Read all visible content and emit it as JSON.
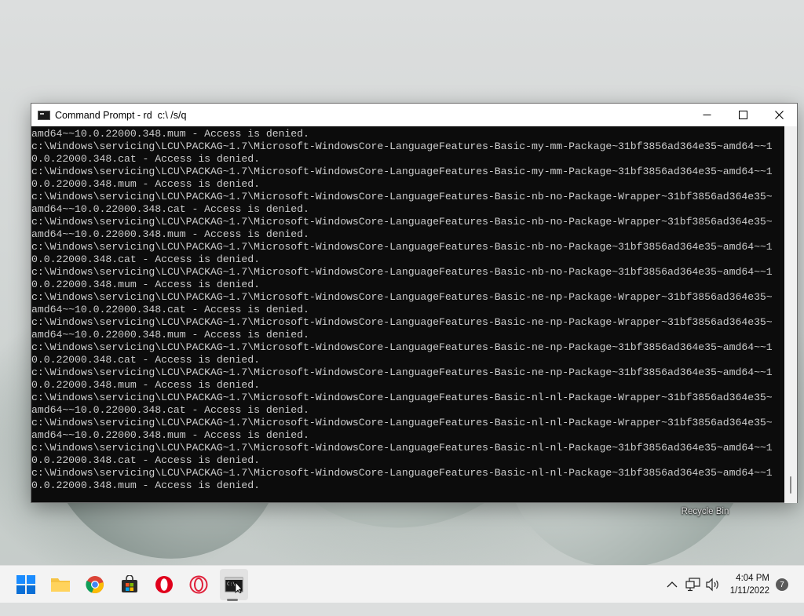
{
  "desktop": {
    "recycle_bin_label": "Recycle Bin"
  },
  "window": {
    "title": "Command Prompt - rd  c:\\ /s/q",
    "controls": {
      "minimize": "minimize-icon",
      "maximize": "maximize-icon",
      "close": "close-icon"
    },
    "console_lines": [
      "amd64~~10.0.22000.348.mum - Access is denied.",
      "c:\\Windows\\servicing\\LCU\\PACKAG~1.7\\Microsoft-WindowsCore-LanguageFeatures-Basic-my-mm-Package~31bf3856ad364e35~amd64~~1",
      "0.0.22000.348.cat - Access is denied.",
      "c:\\Windows\\servicing\\LCU\\PACKAG~1.7\\Microsoft-WindowsCore-LanguageFeatures-Basic-my-mm-Package~31bf3856ad364e35~amd64~~1",
      "0.0.22000.348.mum - Access is denied.",
      "c:\\Windows\\servicing\\LCU\\PACKAG~1.7\\Microsoft-WindowsCore-LanguageFeatures-Basic-nb-no-Package-Wrapper~31bf3856ad364e35~",
      "amd64~~10.0.22000.348.cat - Access is denied.",
      "c:\\Windows\\servicing\\LCU\\PACKAG~1.7\\Microsoft-WindowsCore-LanguageFeatures-Basic-nb-no-Package-Wrapper~31bf3856ad364e35~",
      "amd64~~10.0.22000.348.mum - Access is denied.",
      "c:\\Windows\\servicing\\LCU\\PACKAG~1.7\\Microsoft-WindowsCore-LanguageFeatures-Basic-nb-no-Package~31bf3856ad364e35~amd64~~1",
      "0.0.22000.348.cat - Access is denied.",
      "c:\\Windows\\servicing\\LCU\\PACKAG~1.7\\Microsoft-WindowsCore-LanguageFeatures-Basic-nb-no-Package~31bf3856ad364e35~amd64~~1",
      "0.0.22000.348.mum - Access is denied.",
      "c:\\Windows\\servicing\\LCU\\PACKAG~1.7\\Microsoft-WindowsCore-LanguageFeatures-Basic-ne-np-Package-Wrapper~31bf3856ad364e35~",
      "amd64~~10.0.22000.348.cat - Access is denied.",
      "c:\\Windows\\servicing\\LCU\\PACKAG~1.7\\Microsoft-WindowsCore-LanguageFeatures-Basic-ne-np-Package-Wrapper~31bf3856ad364e35~",
      "amd64~~10.0.22000.348.mum - Access is denied.",
      "c:\\Windows\\servicing\\LCU\\PACKAG~1.7\\Microsoft-WindowsCore-LanguageFeatures-Basic-ne-np-Package~31bf3856ad364e35~amd64~~1",
      "0.0.22000.348.cat - Access is denied.",
      "c:\\Windows\\servicing\\LCU\\PACKAG~1.7\\Microsoft-WindowsCore-LanguageFeatures-Basic-ne-np-Package~31bf3856ad364e35~amd64~~1",
      "0.0.22000.348.mum - Access is denied.",
      "c:\\Windows\\servicing\\LCU\\PACKAG~1.7\\Microsoft-WindowsCore-LanguageFeatures-Basic-nl-nl-Package-Wrapper~31bf3856ad364e35~",
      "amd64~~10.0.22000.348.cat - Access is denied.",
      "c:\\Windows\\servicing\\LCU\\PACKAG~1.7\\Microsoft-WindowsCore-LanguageFeatures-Basic-nl-nl-Package-Wrapper~31bf3856ad364e35~",
      "amd64~~10.0.22000.348.mum - Access is denied.",
      "c:\\Windows\\servicing\\LCU\\PACKAG~1.7\\Microsoft-WindowsCore-LanguageFeatures-Basic-nl-nl-Package~31bf3856ad364e35~amd64~~1",
      "0.0.22000.348.cat - Access is denied.",
      "c:\\Windows\\servicing\\LCU\\PACKAG~1.7\\Microsoft-WindowsCore-LanguageFeatures-Basic-nl-nl-Package~31bf3856ad364e35~amd64~~1",
      "0.0.22000.348.mum - Access is denied."
    ]
  },
  "taskbar": {
    "apps": [
      {
        "name": "start-button",
        "icon": "windows-logo-icon"
      },
      {
        "name": "file-explorer-button",
        "icon": "folder-icon"
      },
      {
        "name": "chrome-button",
        "icon": "chrome-icon"
      },
      {
        "name": "store-button",
        "icon": "store-bag-icon"
      },
      {
        "name": "opera-button",
        "icon": "opera-icon"
      },
      {
        "name": "opera-gx-button",
        "icon": "opera-outline-icon"
      },
      {
        "name": "command-prompt-button",
        "icon": "cmd-icon",
        "active": true
      }
    ],
    "tray": {
      "time": "4:04 PM",
      "date": "1/11/2022",
      "notification_count": "7"
    }
  },
  "colors": {
    "console_bg": "#0c0c0c",
    "console_text": "#cccccc",
    "taskbar_bg": "#f3f3f3",
    "windows_blue": "#0078d4",
    "opera_red": "#e0001b"
  }
}
